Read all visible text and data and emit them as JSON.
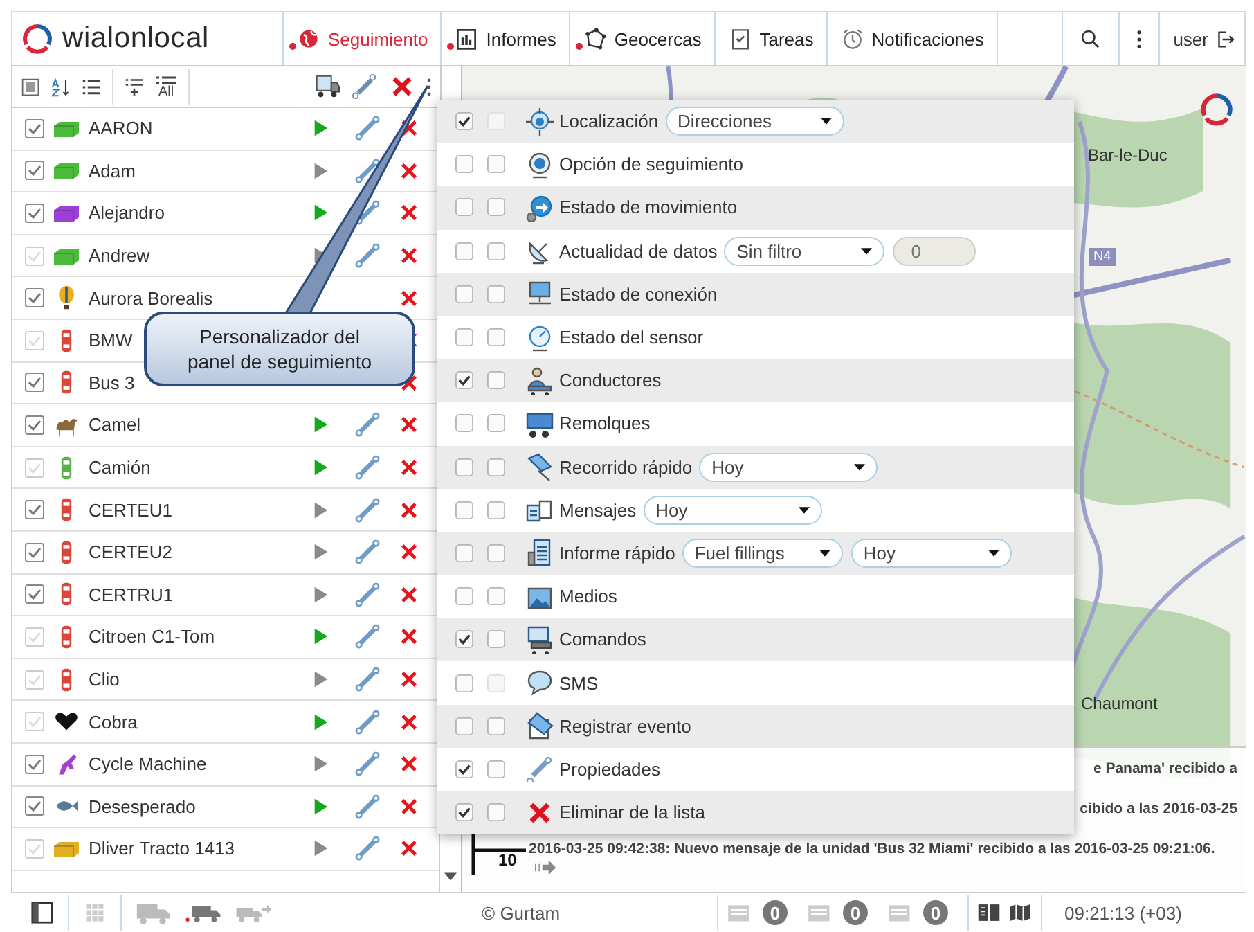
{
  "header": {
    "logo_text": "wialonlocal",
    "tabs": [
      {
        "label": "Seguimiento",
        "selected": true,
        "marked": true
      },
      {
        "label": "Informes",
        "selected": false,
        "marked": true
      },
      {
        "label": "Geocercas",
        "selected": false,
        "marked": true
      },
      {
        "label": "Tareas",
        "selected": false,
        "marked": false
      },
      {
        "label": "Notificaciones",
        "selected": false,
        "marked": false
      }
    ],
    "user": "user"
  },
  "unit_toolbar": {
    "all_label": "All"
  },
  "units": [
    {
      "name": "AARON",
      "checked": true,
      "moving": true,
      "kind": "truck",
      "color": "#4cbb3c"
    },
    {
      "name": "Adam",
      "checked": true,
      "moving": false,
      "kind": "truck",
      "color": "#4cbb3c"
    },
    {
      "name": "Alejandro",
      "checked": true,
      "moving": true,
      "kind": "truck",
      "color": "#9b3fd8"
    },
    {
      "name": "Andrew",
      "checked": false,
      "moving": false,
      "kind": "truck",
      "color": "#4cbb3c"
    },
    {
      "name": "Aurora Borealis",
      "checked": true,
      "kind": "balloon",
      "color": "#e8b020"
    },
    {
      "name": "BMW",
      "checked": false,
      "kind": "car",
      "color": "#d9463a"
    },
    {
      "name": "Bus 3",
      "checked": true,
      "kind": "car",
      "color": "#d9463a"
    },
    {
      "name": "Camel",
      "checked": true,
      "moving": true,
      "kind": "camel",
      "color": "#8a6a3a"
    },
    {
      "name": "Camión",
      "checked": false,
      "moving": true,
      "kind": "car",
      "color": "#5ab04a"
    },
    {
      "name": "CERTEU1",
      "checked": true,
      "moving": false,
      "kind": "car",
      "color": "#d9463a"
    },
    {
      "name": "CERTEU2",
      "checked": true,
      "moving": false,
      "kind": "car",
      "color": "#d9463a"
    },
    {
      "name": "CERTRU1",
      "checked": true,
      "moving": false,
      "kind": "car",
      "color": "#d9463a"
    },
    {
      "name": "Citroen C1-Tom",
      "checked": false,
      "moving": true,
      "kind": "car",
      "color": "#d9463a"
    },
    {
      "name": "Clio",
      "checked": false,
      "moving": false,
      "kind": "car",
      "color": "#d9463a"
    },
    {
      "name": "Cobra",
      "checked": false,
      "moving": true,
      "kind": "heart",
      "color": "#111111"
    },
    {
      "name": "Cycle Machine",
      "checked": true,
      "moving": false,
      "kind": "scooter",
      "color": "#a43fd0"
    },
    {
      "name": "Desesperado",
      "checked": true,
      "moving": true,
      "kind": "fish",
      "color": "#5a7a9a"
    },
    {
      "name": "Dliver Tracto 1413",
      "checked": false,
      "moving": false,
      "kind": "truck",
      "color": "#e0b020"
    }
  ],
  "callout": "Personalizador del panel de seguimiento",
  "map": {
    "labels": [
      "Bar-le-Duc",
      "Chaumont"
    ],
    "road_sign": "N4",
    "scale": "10"
  },
  "column_menu": [
    {
      "label": "Localización",
      "shown": true,
      "secondary": false,
      "secondary_disabled": true,
      "controls": [
        {
          "kind": "select",
          "value": "Direcciones"
        }
      ]
    },
    {
      "label": "Opción de seguimiento",
      "shown": false,
      "secondary": false,
      "secondary_disabled": false
    },
    {
      "label": "Estado de movimiento",
      "shown": false,
      "secondary": false,
      "secondary_disabled": false
    },
    {
      "label": "Actualidad de datos",
      "shown": false,
      "secondary": false,
      "secondary_disabled": false,
      "controls": [
        {
          "kind": "select",
          "value": "Sin filtro"
        },
        {
          "kind": "input",
          "value": "0",
          "disabled": true
        }
      ]
    },
    {
      "label": "Estado de conexión",
      "shown": false,
      "secondary": false,
      "secondary_disabled": false
    },
    {
      "label": "Estado del sensor",
      "shown": false,
      "secondary": false,
      "secondary_disabled": false
    },
    {
      "label": "Conductores",
      "shown": true,
      "secondary": false,
      "secondary_disabled": false
    },
    {
      "label": "Remolques",
      "shown": false,
      "secondary": false,
      "secondary_disabled": false
    },
    {
      "label": "Recorrido rápido",
      "shown": false,
      "secondary": false,
      "secondary_disabled": false,
      "controls": [
        {
          "kind": "select",
          "value": "Hoy"
        }
      ]
    },
    {
      "label": "Mensajes",
      "shown": false,
      "secondary": false,
      "secondary_disabled": false,
      "controls": [
        {
          "kind": "select",
          "value": "Hoy"
        }
      ]
    },
    {
      "label": "Informe rápido",
      "shown": false,
      "secondary": false,
      "secondary_disabled": false,
      "controls": [
        {
          "kind": "select",
          "value": "Fuel fillings"
        },
        {
          "kind": "select",
          "value": "Hoy"
        }
      ]
    },
    {
      "label": "Medios",
      "shown": false,
      "secondary": false,
      "secondary_disabled": false
    },
    {
      "label": "Comandos",
      "shown": true,
      "secondary": false,
      "secondary_disabled": false
    },
    {
      "label": "SMS",
      "shown": false,
      "secondary": false,
      "secondary_disabled": true
    },
    {
      "label": "Registrar evento",
      "shown": false,
      "secondary": false,
      "secondary_disabled": false
    },
    {
      "label": "Propiedades",
      "shown": true,
      "secondary": false,
      "secondary_disabled": false
    },
    {
      "label": "Eliminar de la lista",
      "shown": true,
      "secondary": false,
      "secondary_disabled": false
    }
  ],
  "notifications": [
    {
      "text": "e Panama' recibido a",
      "cut": true
    },
    {
      "text": "cibido a las 2016-03-25",
      "cut": true
    },
    {
      "text": "2016-03-25 09:42:38: Nuevo mensaje de la unidad 'Bus 32 Miami' recibido a las 2016-03-25 09:21:06.",
      "cut": false
    }
  ],
  "status_bar": {
    "copyright": "© Gurtam",
    "counters": [
      "0",
      "0",
      "0"
    ],
    "time": "09:21:13 (+03)"
  }
}
